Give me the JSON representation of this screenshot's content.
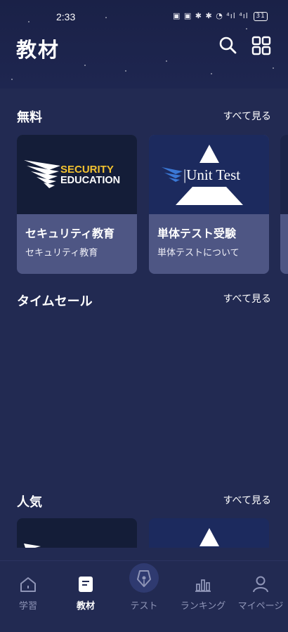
{
  "status_bar": {
    "time": "2:33",
    "icons": "▣ ▣ ✱ ✱ ◔ ⁴ıl ⁴ıl",
    "battery": "31"
  },
  "header": {
    "title": "教材",
    "search_icon": "search-icon",
    "grid_icon": "grid-icon"
  },
  "sections": {
    "free": {
      "title": "無料",
      "see_all": "すべて見る",
      "cards": [
        {
          "title": "セキュリティ教育",
          "subtitle": "セキュリティ教育",
          "thumb_line1": "SECURITY",
          "thumb_line2": "EDUCATION"
        },
        {
          "title": "単体テスト受験",
          "subtitle": "単体テストについて",
          "thumb_text": "Unit Test"
        }
      ]
    },
    "timesale": {
      "title": "タイムセール",
      "see_all": "すべて見る"
    },
    "popular": {
      "title": "人気",
      "see_all": "すべて見る"
    }
  },
  "bottom_nav": [
    {
      "label": "学習",
      "icon": "home-icon",
      "active": false
    },
    {
      "label": "教材",
      "icon": "book-icon",
      "active": true
    },
    {
      "label": "テスト",
      "icon": "pen-nib-icon",
      "active": false
    },
    {
      "label": "ランキング",
      "icon": "bar-chart-icon",
      "active": false
    },
    {
      "label": "マイページ",
      "icon": "user-icon",
      "active": false
    }
  ],
  "colors": {
    "background": "#222a52",
    "card": "#4e5684",
    "accent_yellow": "#f2c230",
    "accent_blue": "#3a78d6",
    "nav_inactive": "#9096b8"
  }
}
